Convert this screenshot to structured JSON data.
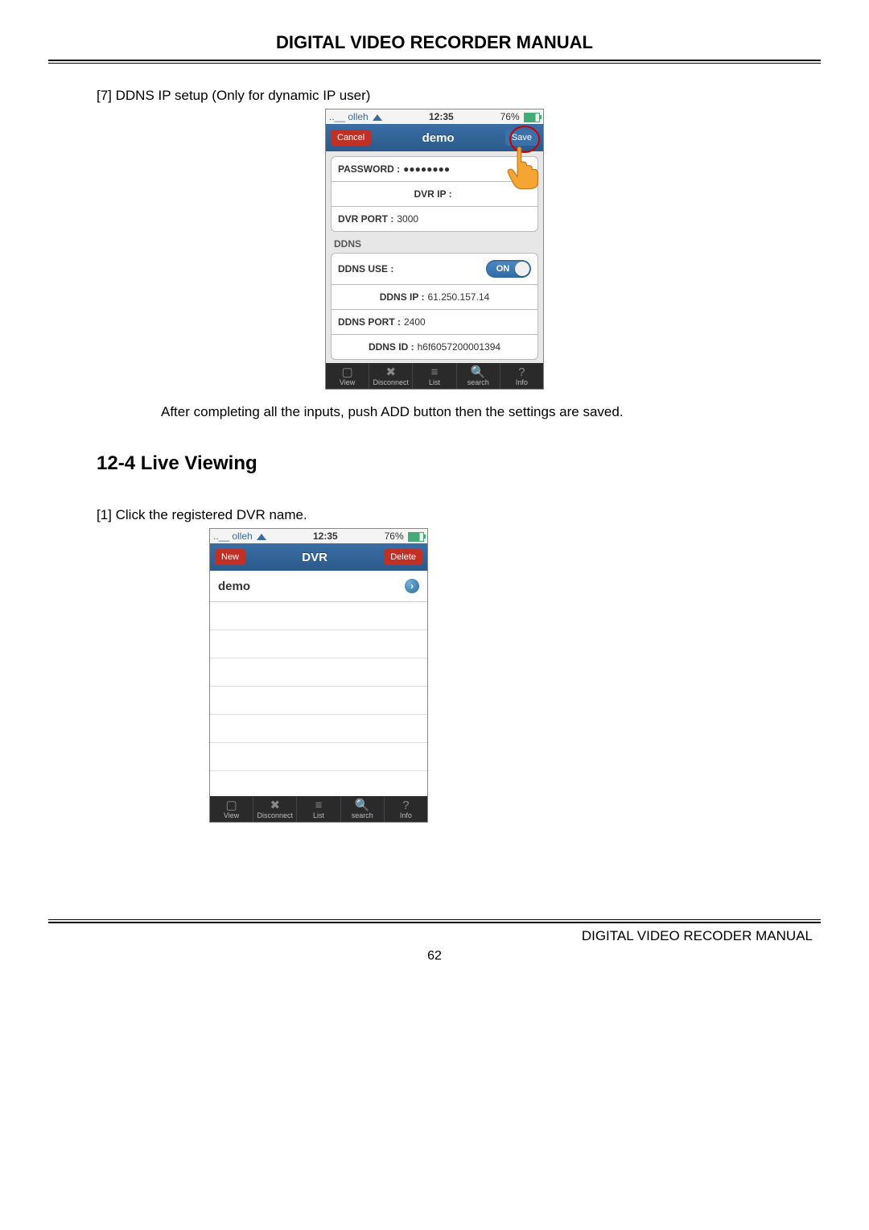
{
  "doc": {
    "header": "DIGITAL VIDEO RECORDER MANUAL",
    "step7": "[7] DDNS IP setup (Only for dynamic IP user)",
    "after_text": "After completing all the inputs, push ADD button then the settings are saved.",
    "section_heading": "12-4 Live Viewing",
    "step1": "[1] Click the registered DVR name.",
    "footer": "DIGITAL VIDEO RECODER MANUAL",
    "page": "62"
  },
  "status": {
    "carrier": "olleh",
    "time": "12:35",
    "battery": "76%"
  },
  "screen1": {
    "cancel": "Cancel",
    "title": "demo",
    "save": "Save",
    "password_label": "PASSWORD :",
    "password_value": "●●●●●●●●",
    "dvr_ip_label": "DVR IP :",
    "dvr_ip_value": "",
    "dvr_port_label": "DVR PORT :",
    "dvr_port_value": "3000",
    "ddns_section": "DDNS",
    "ddns_use_label": "DDNS USE :",
    "ddns_use_value": "ON",
    "ddns_ip_label": "DDNS IP :",
    "ddns_ip_value": "61.250.157.14",
    "ddns_port_label": "DDNS PORT :",
    "ddns_port_value": "2400",
    "ddns_id_label": "DDNS ID :",
    "ddns_id_value": "h6f6057200001394"
  },
  "screen2": {
    "new": "New",
    "title": "DVR",
    "delete": "Delete",
    "item": "demo"
  },
  "toolbar": {
    "view": "View",
    "disconnect": "Disconnect",
    "list": "List",
    "search": "search",
    "info": "Info"
  }
}
